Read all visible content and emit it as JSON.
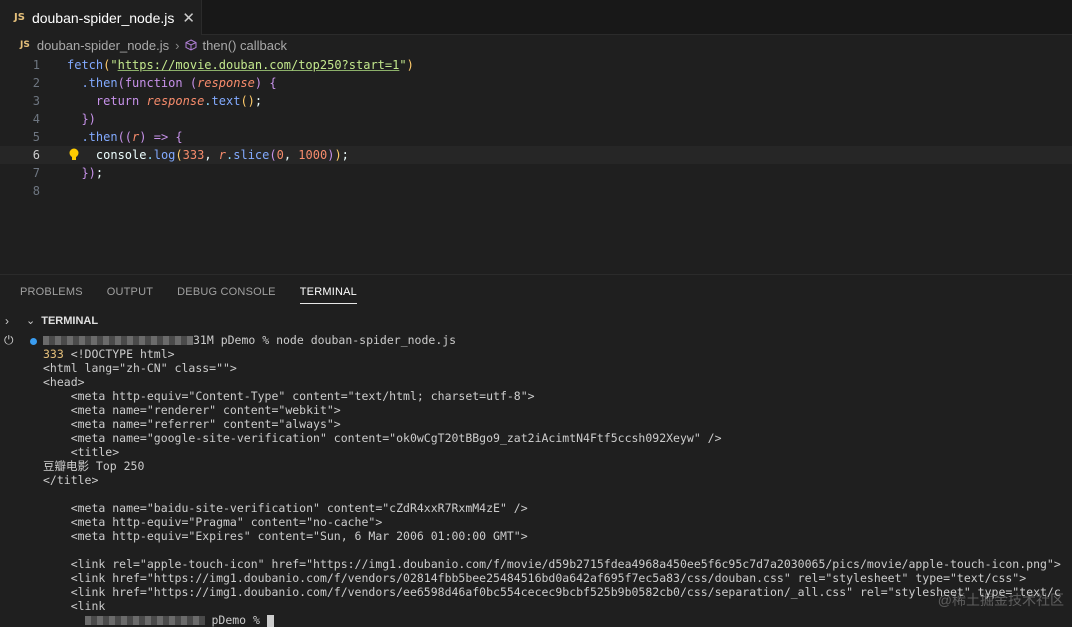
{
  "tab": {
    "icon": "JS",
    "filename": "douban-spider_node.js",
    "close": "✕"
  },
  "breadcrumb": {
    "icon": "JS",
    "file": "douban-spider_node.js",
    "symbol": "then() callback"
  },
  "editor": {
    "line_numbers": [
      "1",
      "2",
      "3",
      "4",
      "5",
      "6",
      "7",
      "8"
    ],
    "active_line": "6"
  },
  "code": {
    "l1_fn": "fetch",
    "l1_url": "https://movie.douban.com/top250?start=1",
    "l2_then": ".then",
    "l2_kw": "function",
    "l2_param": "response",
    "l3_kw": "return",
    "l3_obj": "response",
    "l3_method": "text",
    "l5_then": ".then",
    "l5_param": "r",
    "l6_obj": "console",
    "l6_method": "log",
    "l6_n1": "333",
    "l6_r": "r",
    "l6_slice": "slice",
    "l6_n2": "0",
    "l6_n3": "1000"
  },
  "panel": {
    "tabs": [
      "PROBLEMS",
      "OUTPUT",
      "DEBUG CONSOLE",
      "TERMINAL"
    ],
    "active_tab": "TERMINAL",
    "section_title": "TERMINAL"
  },
  "terminal": {
    "prompt_suffix": "31M pDemo % node douban-spider_node.js",
    "lines": [
      "<!DOCTYPE html>",
      "<html lang=\"zh-CN\" class=\"\">",
      "<head>",
      "    <meta http-equiv=\"Content-Type\" content=\"text/html; charset=utf-8\">",
      "    <meta name=\"renderer\" content=\"webkit\">",
      "    <meta name=\"referrer\" content=\"always\">",
      "    <meta name=\"google-site-verification\" content=\"ok0wCgT20tBBgo9_zat2iAcimtN4Ftf5ccsh092Xeyw\" />",
      "    <title>",
      "豆瓣电影 Top 250",
      "</title>",
      "",
      "    <meta name=\"baidu-site-verification\" content=\"cZdR4xxR7RxmM4zE\" />",
      "    <meta http-equiv=\"Pragma\" content=\"no-cache\">",
      "    <meta http-equiv=\"Expires\" content=\"Sun, 6 Mar 2006 01:00:00 GMT\">",
      "",
      "    <link rel=\"apple-touch-icon\" href=\"https://img1.doubanio.com/f/movie/d59b2715fdea4968a450ee5f6c95c7d7a2030065/pics/movie/apple-touch-icon.png\">",
      "    <link href=\"https://img1.doubanio.com/f/vendors/02814fbb5bee25484516bd0a642af695f7ec5a83/css/douban.css\" rel=\"stylesheet\" type=\"text/css\">",
      "    <link href=\"https://img1.doubanio.com/f/vendors/ee6598d46af0bc554cecec9bcbf525b9b0582cb0/css/separation/_all.css\" rel=\"stylesheet\" type=\"text/c",
      "    <link"
    ],
    "first_prefix": "333 ",
    "last_line_prefix": "      ",
    "last_line_suffix": " pDemo % "
  },
  "watermark": "@稀土掘金技术社区"
}
